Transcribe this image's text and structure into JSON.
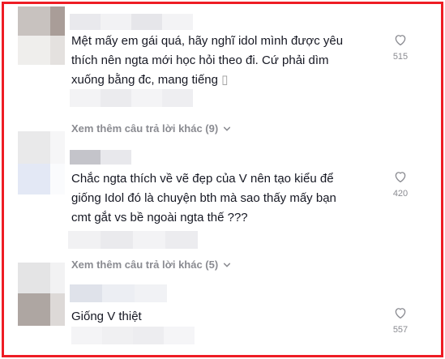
{
  "comments": [
    {
      "text_lines": [
        "Mệt mấy em gái quá, hãy nghĩ idol mình được yêu",
        "thích nên ngta mới học hỏi theo đi. Cứ phải dìm",
        "xuống bằng đc, mang tiếng"
      ],
      "tofu_glyph": "▯",
      "like_count": "515",
      "view_more": "Xem thêm câu trả lời khác (9)"
    },
    {
      "text_lines": [
        "Chắc ngta thích về vẽ đẹp của V nên tạo kiểu để",
        "giống Idol đó là chuyện bth mà sao thấy mấy bạn",
        "cmt gắt vs bề ngoài ngta thế ???"
      ],
      "like_count": "420",
      "view_more": "Xem thêm câu trả lời khác (5)"
    },
    {
      "text_lines": [
        "Giống V thiệt"
      ],
      "like_count": "557"
    }
  ],
  "colors": {
    "border": "#ee1c24",
    "text": "#161823",
    "muted": "#8a8b91"
  },
  "icons": {
    "like": "heart-outline-icon",
    "expand": "chevron-down-icon"
  }
}
